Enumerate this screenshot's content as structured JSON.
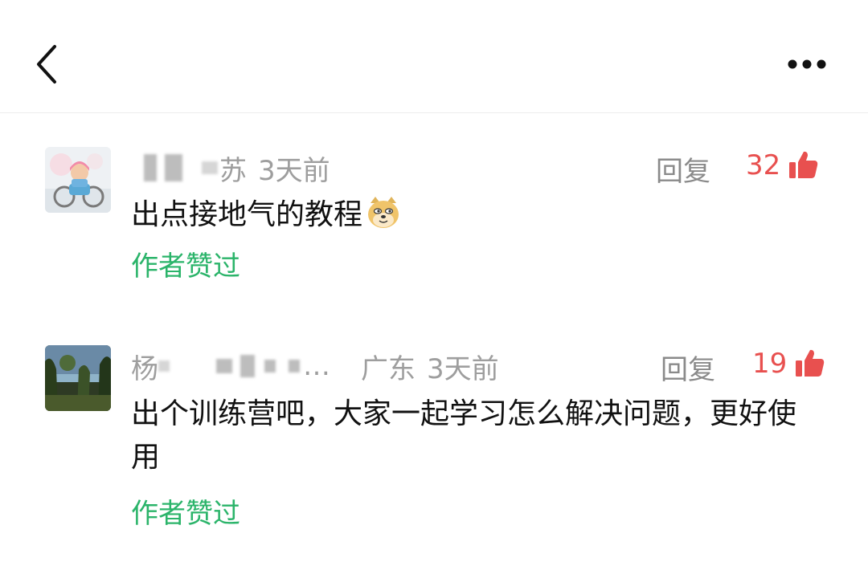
{
  "header": {
    "back_icon": "chevron-left-icon",
    "more_icon": "more-horizontal-icon"
  },
  "comments": [
    {
      "name_visible": "苏",
      "time": "3天前",
      "reply_label": "回复",
      "likes": "32",
      "text": "出点接地气的教程",
      "emoji": "doge-emoji",
      "author_liked": "作者赞过"
    },
    {
      "name_visible_start": "杨",
      "name_visible_end": "…",
      "region": "广东",
      "time": "3天前",
      "reply_label": "回复",
      "likes": "19",
      "text": "出个训练营吧，大家一起学习怎么解决问题，更好使用",
      "author_liked": "作者赞过"
    }
  ],
  "colors": {
    "like_red": "#e8504f",
    "author_green": "#2bb46a",
    "meta_gray": "#9e9e9e"
  }
}
